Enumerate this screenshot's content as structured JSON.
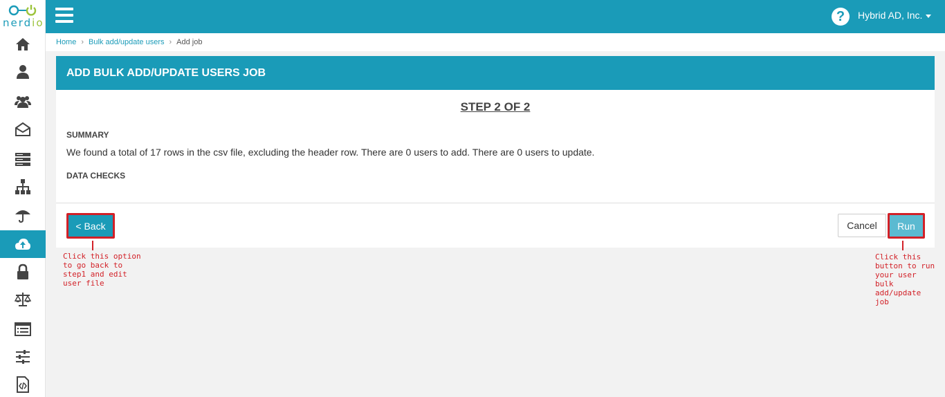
{
  "logo": {
    "part1": "nerd",
    "part2": "io"
  },
  "topbar": {
    "company": "Hybrid AD, Inc."
  },
  "breadcrumb": {
    "home": "Home",
    "bulk": "Bulk add/update users",
    "current": "Add job",
    "sep": "›"
  },
  "panel": {
    "title": "ADD BULK ADD/UPDATE USERS JOB",
    "step": "STEP 2 OF 2",
    "summary_title": "SUMMARY",
    "summary_text": "We found a total of 17 rows in the csv file, excluding the header row. There are 0 users to add. There are 0 users to update.",
    "data_checks_title": "DATA CHECKS"
  },
  "buttons": {
    "back": "< Back",
    "cancel": "Cancel",
    "run": "Run"
  },
  "annotations": {
    "back": "Click this option\nto go back to\nstep1 and edit\nuser file",
    "run": "Click this\nbutton to run\nyour user\nbulk\nadd/update\njob"
  },
  "colors": {
    "accent": "#1a9bb8",
    "annotation": "#d22027",
    "logo_green": "#9cc33b"
  },
  "sidebar": {
    "items": [
      {
        "icon": "home-icon"
      },
      {
        "icon": "user-icon"
      },
      {
        "icon": "users-group-icon"
      },
      {
        "icon": "mailbox-icon"
      },
      {
        "icon": "servers-icon"
      },
      {
        "icon": "org-chart-icon"
      },
      {
        "icon": "umbrella-icon"
      },
      {
        "icon": "cloud-upload-icon",
        "active": true
      },
      {
        "icon": "lock-icon"
      },
      {
        "icon": "scales-icon"
      },
      {
        "icon": "list-icon"
      },
      {
        "icon": "sliders-icon"
      },
      {
        "icon": "code-file-icon"
      }
    ]
  }
}
